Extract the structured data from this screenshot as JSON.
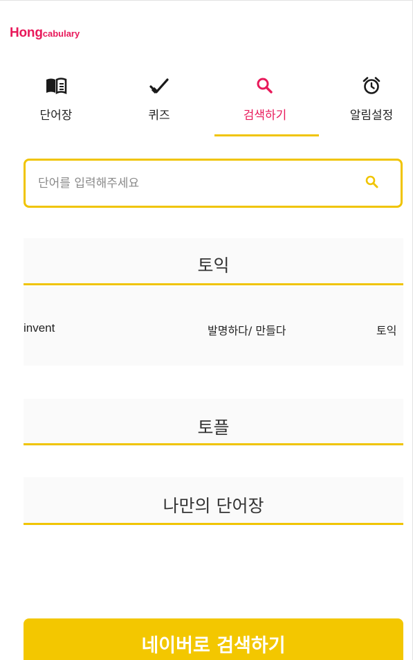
{
  "app": {
    "logo_main": "Hong",
    "logo_sub": "cabulary"
  },
  "nav": {
    "items": [
      {
        "label": "단어장",
        "icon": "book-icon"
      },
      {
        "label": "퀴즈",
        "icon": "checkmark-icon"
      },
      {
        "label": "검색하기",
        "icon": "search-icon",
        "active": true
      },
      {
        "label": "알림설정",
        "icon": "alarm-clock-icon"
      }
    ]
  },
  "search": {
    "placeholder": "단어를 입력해주세요",
    "value": ""
  },
  "sections": [
    {
      "title": "토익",
      "rows": [
        {
          "word": "invent",
          "meaning": "발명하다/ 만들다",
          "category": "토익"
        }
      ]
    },
    {
      "title": "토플",
      "rows": []
    },
    {
      "title": "나만의 단어장",
      "rows": []
    }
  ],
  "naver_button": {
    "label": "네이버로 검색하기"
  },
  "colors": {
    "brand": "#e8195a",
    "accent": "#f0c400",
    "button": "#f3c700"
  }
}
